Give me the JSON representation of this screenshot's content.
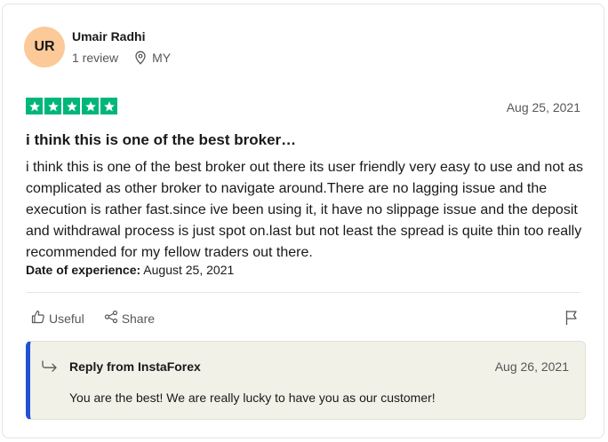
{
  "reviewer": {
    "initials": "UR",
    "name": "Umair Radhi",
    "review_count": "1 review",
    "country": "MY"
  },
  "review": {
    "rating": 5,
    "date": "Aug 25, 2021",
    "title": "i think this is one of the best broker…",
    "body": "i think this is one of the best broker out there its user friendly very easy to use and not as complicated as other broker to navigate around.There are no lagging issue and the execution is rather fast.since ive been using it, it have no slippage issue and the deposit and withdrawal process is just spot on.last but not least the spread is quite thin too really recommended for my fellow traders out there.",
    "experience_label": "Date of experience:",
    "experience_date": "August 25, 2021"
  },
  "actions": {
    "useful_label": "Useful",
    "share_label": "Share"
  },
  "reply": {
    "heading": "Reply from InstaForex",
    "date": "Aug 26, 2021",
    "text": "You are the best! We are really lucky to have you as our customer!"
  },
  "colors": {
    "star_green": "#00b67a",
    "avatar_bg": "#fcc998",
    "reply_accent": "#2350d6",
    "reply_bg": "#f1f1e8"
  }
}
